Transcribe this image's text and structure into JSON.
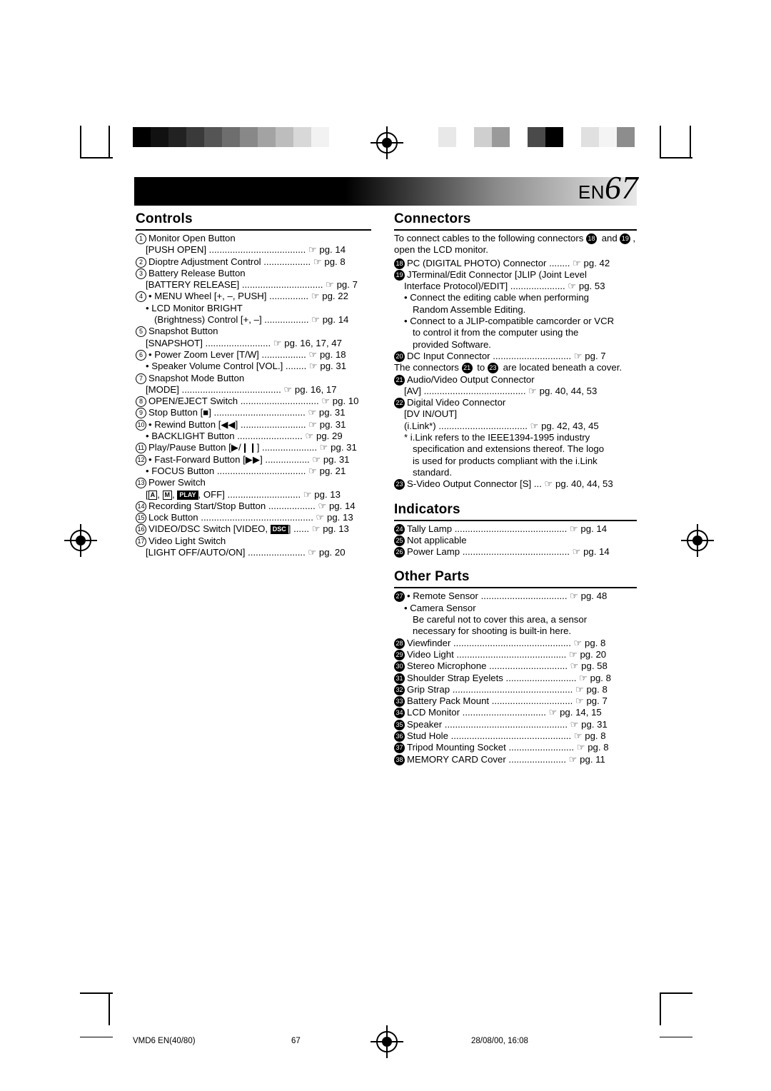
{
  "page": {
    "header_label": "EN",
    "header_number": "67"
  },
  "footer": {
    "file": "VMD6 EN(40/80)",
    "page": "67",
    "date": "28/08/00, 16:08"
  },
  "sections": {
    "controls": {
      "title": "Controls",
      "items": [
        {
          "num": "1",
          "text": "Monitor Open Button"
        },
        {
          "indent": 1,
          "text": "[PUSH OPEN] ..................................... ☞ pg. 14"
        },
        {
          "num": "2",
          "text": "Dioptre Adjustment Control .................. ☞ pg. 8"
        },
        {
          "num": "3",
          "text": "Battery Release Button"
        },
        {
          "indent": 1,
          "text": "[BATTERY RELEASE] ............................... ☞ pg. 7"
        },
        {
          "num": "4",
          "text": "• MENU Wheel [+, –, PUSH] ............... ☞ pg. 22"
        },
        {
          "indent": 1,
          "text": "• LCD Monitor BRIGHT"
        },
        {
          "indent": 2,
          "text": "(Brightness) Control [+, –] ................. ☞ pg. 14"
        },
        {
          "num": "5",
          "text": "Snapshot Button"
        },
        {
          "indent": 1,
          "text": "[SNAPSHOT] ......................... ☞ pg. 16, 17, 47"
        },
        {
          "num": "6",
          "text": "• Power Zoom Lever [T/W] ................. ☞ pg. 18"
        },
        {
          "indent": 1,
          "text": "• Speaker Volume Control [VOL.] ........ ☞ pg. 31"
        },
        {
          "num": "7",
          "text": "Snapshot Mode Button"
        },
        {
          "indent": 1,
          "text": "[MODE] ...................................... ☞ pg. 16, 17"
        },
        {
          "num": "8",
          "text": "OPEN/EJECT Switch .............................. ☞ pg. 10"
        },
        {
          "num": "9",
          "text": "Stop Button [■] ................................... ☞ pg. 31"
        },
        {
          "num": "10",
          "text": "• Rewind Button [◀◀] ......................... ☞ pg. 31"
        },
        {
          "indent": 1,
          "text": "• BACKLIGHT Button ......................... ☞ pg. 29"
        },
        {
          "num": "11",
          "text": "Play/Pause Button [▶/❙❙] ..................... ☞ pg. 31"
        },
        {
          "num": "12",
          "text": "• Fast-Forward Button [▶▶] ................. ☞ pg. 31"
        },
        {
          "indent": 1,
          "text": "• FOCUS Button .................................. ☞ pg. 21"
        },
        {
          "num": "13",
          "text": "Power Switch"
        },
        {
          "num": "14",
          "text": "Recording Start/Stop Button .................. ☞ pg. 14"
        },
        {
          "num": "15",
          "text": "Lock Button ........................................... ☞ pg. 13"
        },
        {
          "num": "17",
          "text": "Video Light Switch"
        },
        {
          "indent": 1,
          "text": "[LIGHT OFF/AUTO/ON] ...................... ☞ pg. 20"
        }
      ],
      "power_switch_line": {
        "prefix": "[",
        "keys": [
          "A",
          "M",
          "PLAY"
        ],
        "suffix": ", OFF] ............................ ☞ pg. 13"
      },
      "video_dsc_line": {
        "num": "16",
        "prefix": "VIDEO/DSC Switch [VIDEO, ",
        "key": "DSC",
        "suffix": "] ...... ☞ pg. 13"
      }
    },
    "connectors": {
      "title": "Connectors",
      "intro_a": "To connect cables to the following connectors",
      "intro_num1": "18",
      "intro_mid": "and",
      "intro_num2": "19",
      "intro_b": ",",
      "intro_c": "open the LCD monitor.",
      "items": [
        {
          "num": "18",
          "text": "PC (DIGITAL PHOTO) Connector ........ ☞ pg. 42"
        },
        {
          "num": "19",
          "text": "JTerminal/Edit Connector [JLIP (Joint Level"
        },
        {
          "indent": 1,
          "text": "Interface Protocol)/EDIT] ..................... ☞ pg. 53"
        },
        {
          "indent": 1,
          "text": "• Connect the editing cable when performing"
        },
        {
          "indent": 2,
          "text": "Random Assemble Editing."
        },
        {
          "indent": 1,
          "text": "• Connect to a JLIP-compatible camcorder or VCR"
        },
        {
          "indent": 2,
          "text": "to control it from the computer using the"
        },
        {
          "indent": 2,
          "text": "provided Software."
        },
        {
          "num": "20",
          "text": "DC Input Connector .............................. ☞ pg. 7"
        }
      ],
      "cover_note": {
        "a": "The connectors",
        "num1": "21",
        "b": "to",
        "num2": "23",
        "c": "are located beneath a cover."
      },
      "items2": [
        {
          "num": "21",
          "text": "Audio/Video Output Connector"
        },
        {
          "indent": 1,
          "text": "[AV] ....................................... ☞ pg. 40, 44, 53"
        },
        {
          "num": "22",
          "text": "Digital Video Connector"
        },
        {
          "indent": 1,
          "text": "[DV IN/OUT]"
        },
        {
          "indent": 1,
          "text": "(i.Link*) .................................. ☞ pg. 42, 43, 45"
        },
        {
          "indent": 1,
          "text": "*  i.Link refers to the IEEE1394-1995 industry"
        },
        {
          "indent": 2,
          "text": "specification and extensions thereof. The      logo"
        },
        {
          "indent": 2,
          "text": "is used for products compliant with the i.Link"
        },
        {
          "indent": 2,
          "text": "standard."
        },
        {
          "num": "23",
          "text": "S-Video Output Connector [S] ... ☞ pg. 40, 44, 53"
        }
      ]
    },
    "indicators": {
      "title": "Indicators",
      "items": [
        {
          "num": "24",
          "text": "Tally Lamp ........................................... ☞ pg. 14"
        },
        {
          "num": "25",
          "text": "Not applicable"
        },
        {
          "num": "26",
          "text": "Power Lamp ......................................... ☞ pg. 14"
        }
      ]
    },
    "other_parts": {
      "title": "Other Parts",
      "items": [
        {
          "num": "27",
          "text": "• Remote Sensor ................................. ☞ pg. 48"
        },
        {
          "indent": 1,
          "text": "• Camera Sensor"
        },
        {
          "indent": 2,
          "text": "Be careful not to cover this area, a sensor"
        },
        {
          "indent": 2,
          "text": "necessary for shooting is built-in here."
        },
        {
          "num": "28",
          "text": "Viewfinder ............................................. ☞ pg. 8"
        },
        {
          "num": "29",
          "text": "Video Light .......................................... ☞ pg. 20"
        },
        {
          "num": "30",
          "text": "Stereo Microphone .............................. ☞ pg. 58"
        },
        {
          "num": "31",
          "text": "Shoulder Strap Eyelets ........................... ☞ pg. 8"
        },
        {
          "num": "32",
          "text": "Grip Strap .............................................. ☞ pg. 8"
        },
        {
          "num": "33",
          "text": "Battery Pack Mount ............................... ☞ pg. 7"
        },
        {
          "num": "34",
          "text": "LCD Monitor ................................ ☞ pg. 14, 15"
        },
        {
          "num": "35",
          "text": "Speaker ............................................... ☞ pg. 31"
        },
        {
          "num": "36",
          "text": "Stud Hole .............................................. ☞ pg. 8"
        },
        {
          "num": "37",
          "text": "Tripod Mounting Socket ......................... ☞ pg. 8"
        },
        {
          "num": "38",
          "text": "MEMORY CARD Cover ...................... ☞ pg. 11"
        }
      ]
    }
  },
  "colorbars": {
    "left": [
      "#000000",
      "#111111",
      "#222222",
      "#3a3a3a",
      "#555555",
      "#6e6e6e",
      "#888888",
      "#a3a3a3",
      "#bdbdbd",
      "#d8d8d8",
      "#f2f2f2"
    ],
    "right": [
      "#e8e8e8",
      "#ffffff",
      "#cfcfcf",
      "#9a9a9a",
      "#ffffff",
      "#4a4a4a",
      "#000000",
      "#ffffff",
      "#e0e0e0",
      "#f4f4f4",
      "#8d8d8d"
    ]
  }
}
